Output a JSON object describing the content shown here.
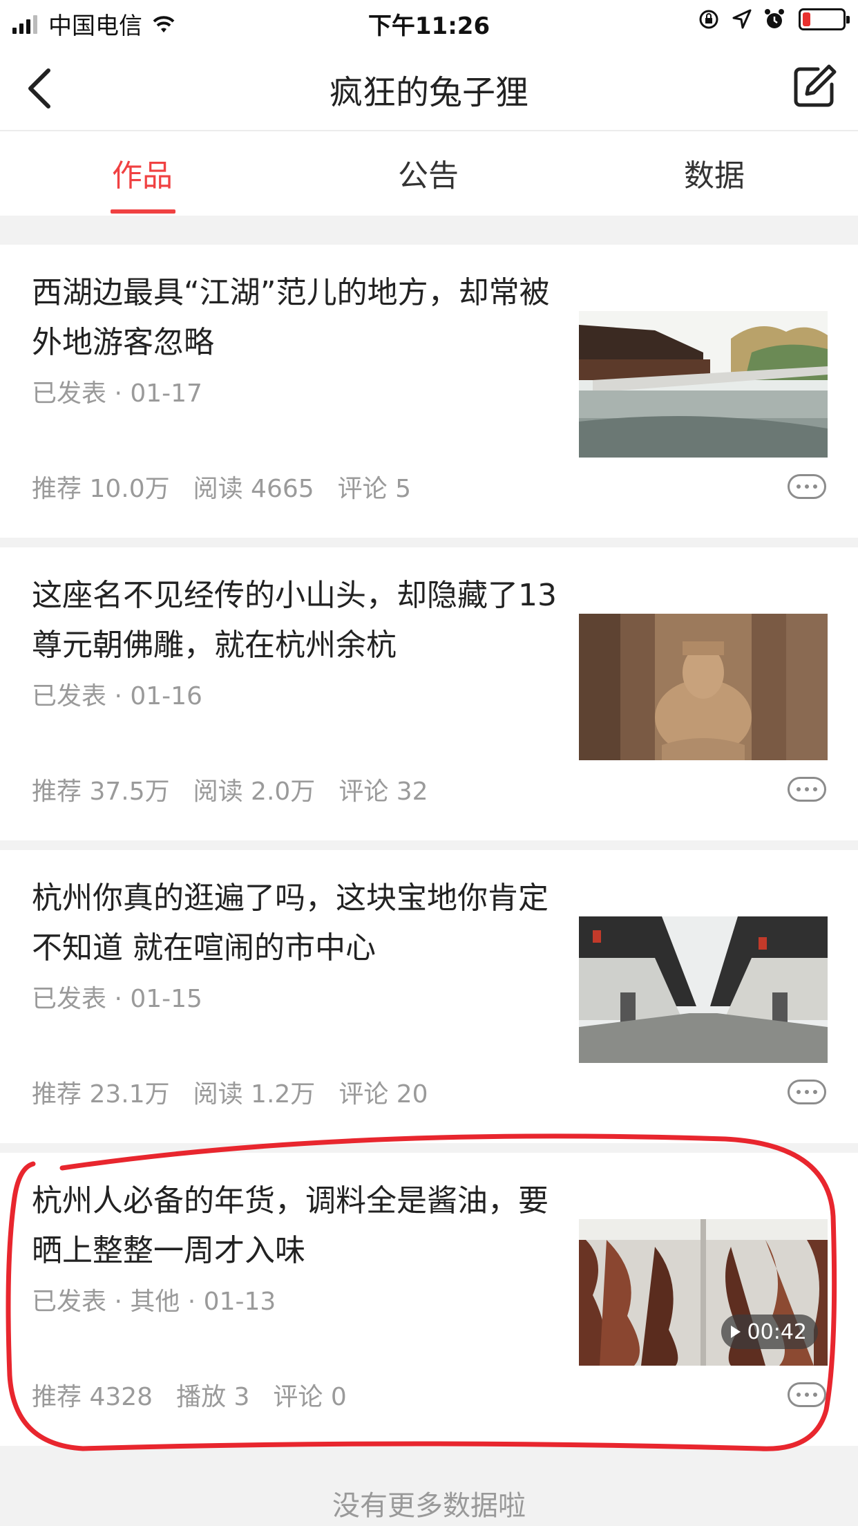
{
  "status_bar": {
    "carrier": "中国电信",
    "time": "下午11:26",
    "battery_level": 0.2,
    "battery_color": "#e8302e"
  },
  "nav": {
    "title": "疯狂的兔子狸",
    "back_icon": "chevron-left-icon",
    "edit_icon": "edit-icon"
  },
  "tabs": [
    {
      "label": "作品",
      "active": true
    },
    {
      "label": "公告",
      "active": false
    },
    {
      "label": "数据",
      "active": false
    }
  ],
  "accent_color": "#f04142",
  "articles": [
    {
      "title": "西湖边最具“江湖”范儿的地方，却常被外地游客忽略",
      "meta": "已发表 · 01-17",
      "stats": [
        "推荐 10.0万",
        "阅读 4665",
        "评论 5"
      ],
      "thumbnail": "lake-pavilion-photo"
    },
    {
      "title": "这座名不见经传的小山头，却隐藏了13尊元朝佛雕，就在杭州余杭",
      "meta": "已发表 · 01-16",
      "stats": [
        "推荐 37.5万",
        "阅读 2.0万",
        "评论 32"
      ],
      "thumbnail": "buddha-carving-photo"
    },
    {
      "title": "杭州你真的逛遍了吗，这块宝地你肯定不知道 就在喧闹的市中心",
      "meta": "已发表 · 01-15",
      "stats": [
        "推荐 23.1万",
        "阅读 1.2万",
        "评论 20"
      ],
      "thumbnail": "old-street-photo"
    },
    {
      "title": "杭州人必备的年货，调料全是酱油，要晒上整整一周才入味",
      "meta": "已发表 · 其他 · 01-13",
      "stats": [
        "推荐 4328",
        "播放 3",
        "评论 0"
      ],
      "thumbnail": "cured-duck-video",
      "video_duration": "00:42"
    }
  ],
  "footer": "没有更多数据啦"
}
